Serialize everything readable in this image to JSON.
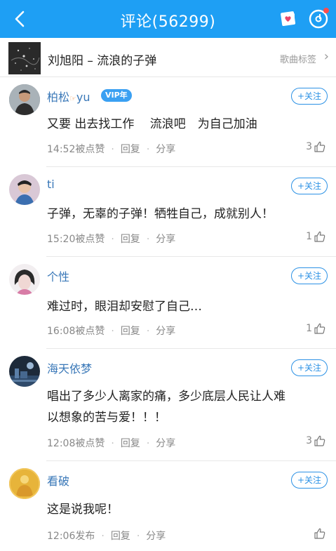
{
  "header": {
    "title": "评论(56299)",
    "accent_color": "#1e9ff4"
  },
  "song": {
    "title": "刘旭阳 – 流浪的子弹",
    "tag_label": "歌曲标签"
  },
  "follow_label": "+关注",
  "comments": [
    {
      "user": "柏松",
      "user_suffix": "yu",
      "vip": "VIP年",
      "text_lines": [
        "又要 出去找工作　 流浪吧　为自己加油"
      ],
      "time": "14:52被点赞",
      "reply": "回复",
      "share": "分享",
      "likes": "3",
      "avatar": "person-avatar"
    },
    {
      "user": "ti",
      "text_lines": [
        "子弹，无辜的子弹！牺牲自己，成就别人！"
      ],
      "time": "15:20被点赞",
      "reply": "回复",
      "share": "分享",
      "likes": "1",
      "avatar": "person-avatar"
    },
    {
      "user": "个性",
      "text_lines": [
        "难过时，眼泪却安慰了自己…"
      ],
      "time": "16:08被点赞",
      "reply": "回复",
      "share": "分享",
      "likes": "1",
      "avatar": "person-avatar"
    },
    {
      "user": "海天依梦",
      "text_lines": [
        "唱出了多少人离家的痛，多少底层人民让人难",
        "以想象的苦与爱！！！"
      ],
      "time": "12:08被点赞",
      "reply": "回复",
      "share": "分享",
      "likes": "3",
      "avatar": "scene-avatar"
    },
    {
      "user": "看破",
      "text_lines": [
        "这是说我呢！"
      ],
      "time": "12:06发布",
      "reply": "回复",
      "share": "分享",
      "likes": "",
      "avatar": "buddha-avatar"
    }
  ]
}
